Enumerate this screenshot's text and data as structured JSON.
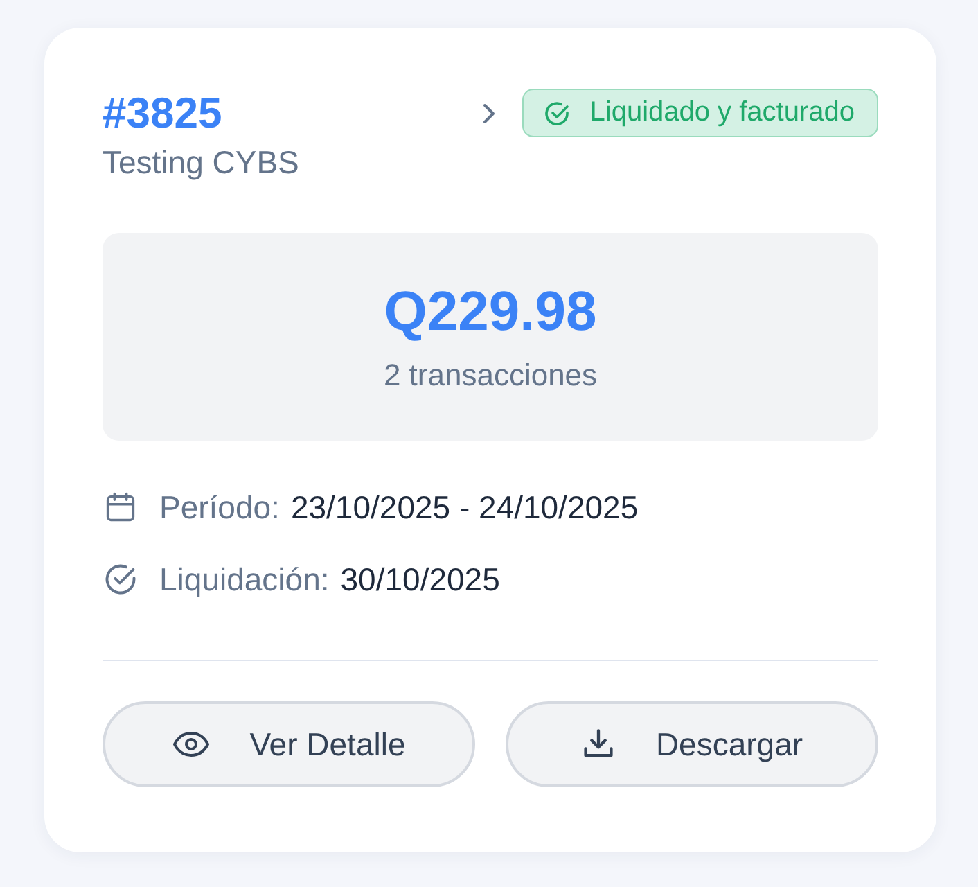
{
  "card": {
    "number": "#3825",
    "subtitle": "Testing CYBS",
    "status": {
      "label": "Liquidado y facturado",
      "kind": "success"
    },
    "amount": "Q229.98",
    "transactions": "2 transacciones",
    "details": [
      {
        "kind": "calendar",
        "label": "Período:",
        "value": "23/10/2025 - 24/10/2025"
      },
      {
        "kind": "check",
        "label": "Liquidación:",
        "value": "30/10/2025"
      }
    ],
    "buttons": [
      {
        "kind": "view",
        "label": "Ver Detalle"
      },
      {
        "kind": "download",
        "label": "Descargar"
      }
    ]
  }
}
